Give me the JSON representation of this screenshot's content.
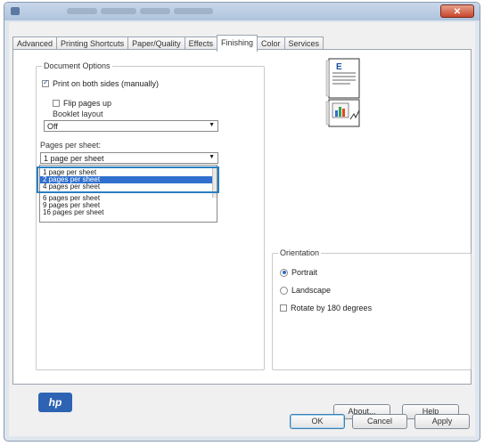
{
  "window": {
    "close_glyph": "✕"
  },
  "tabs": [
    {
      "label": "Advanced"
    },
    {
      "label": "Printing Shortcuts"
    },
    {
      "label": "Paper/Quality"
    },
    {
      "label": "Effects"
    },
    {
      "label": "Finishing"
    },
    {
      "label": "Color"
    },
    {
      "label": "Services"
    }
  ],
  "active_tab": "Finishing",
  "document_options": {
    "group_label": "Document Options",
    "print_both_sides": "Print on both sides (manually)",
    "print_both_sides_checked": true,
    "flip_pages_up": "Flip pages up",
    "flip_pages_up_checked": false,
    "booklet_layout_label": "Booklet layout",
    "booklet_layout_value": "Off",
    "pages_per_sheet_label": "Pages per sheet:",
    "pages_per_sheet_value": "1 page per sheet",
    "pages_per_sheet_options": [
      "1 page per sheet",
      "2 pages per sheet",
      "4 pages per sheet",
      "6 pages per sheet",
      "9 pages per sheet",
      "16 pages per sheet"
    ],
    "highlighted_option": "2 pages per sheet"
  },
  "orientation": {
    "group_label": "Orientation",
    "portrait": "Portrait",
    "landscape": "Landscape",
    "selected": "Portrait",
    "rotate": "Rotate by 180 degrees",
    "rotate_checked": false
  },
  "buttons": {
    "about": "About...",
    "help": "Help",
    "ok": "OK",
    "cancel": "Cancel",
    "apply": "Apply"
  },
  "logo": {
    "text": "hp"
  },
  "colors": {
    "highlight_border": "#2a7fc0",
    "selection": "#2f6fce",
    "close_button": "#c8462c"
  }
}
